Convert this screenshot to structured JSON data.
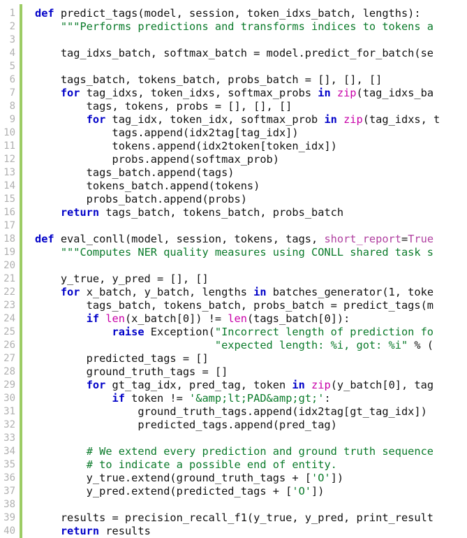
{
  "colors": {
    "keyword": "#0000c8",
    "string": "#0a7a2a",
    "comment": "#0a7a2a",
    "builtin": "#c800a8",
    "keyword_argument": "#b040a0",
    "line_number": "#b0b0b0",
    "change_bar": "#9ccc65",
    "text": "#111111"
  },
  "lines": [
    {
      "n": "1",
      "tokens": [
        {
          "t": "kw",
          "v": "def"
        },
        {
          "t": "p",
          "v": " predict_tags(model, session, token_idxs_batch, lengths):"
        }
      ]
    },
    {
      "n": "2",
      "tokens": [
        {
          "t": "p",
          "v": "    "
        },
        {
          "t": "str",
          "v": "\"\"\"Performs predictions and transforms indices to tokens a"
        }
      ]
    },
    {
      "n": "3",
      "tokens": []
    },
    {
      "n": "4",
      "tokens": [
        {
          "t": "p",
          "v": "    tag_idxs_batch, softmax_batch = model.predict_for_batch(se"
        }
      ]
    },
    {
      "n": "5",
      "tokens": []
    },
    {
      "n": "6",
      "tokens": [
        {
          "t": "p",
          "v": "    tags_batch, tokens_batch, probs_batch = [], [], []"
        }
      ]
    },
    {
      "n": "7",
      "tokens": [
        {
          "t": "p",
          "v": "    "
        },
        {
          "t": "kw",
          "v": "for"
        },
        {
          "t": "p",
          "v": " tag_idxs, token_idxs, softmax_probs "
        },
        {
          "t": "kw",
          "v": "in"
        },
        {
          "t": "p",
          "v": " "
        },
        {
          "t": "bi",
          "v": "zip"
        },
        {
          "t": "p",
          "v": "(tag_idxs_ba"
        }
      ]
    },
    {
      "n": "8",
      "tokens": [
        {
          "t": "p",
          "v": "        tags, tokens, probs = [], [], []"
        }
      ]
    },
    {
      "n": "9",
      "tokens": [
        {
          "t": "p",
          "v": "        "
        },
        {
          "t": "kw",
          "v": "for"
        },
        {
          "t": "p",
          "v": " tag_idx, token_idx, softmax_prob "
        },
        {
          "t": "kw",
          "v": "in"
        },
        {
          "t": "p",
          "v": " "
        },
        {
          "t": "bi",
          "v": "zip"
        },
        {
          "t": "p",
          "v": "(tag_idxs, t"
        }
      ]
    },
    {
      "n": "10",
      "tokens": [
        {
          "t": "p",
          "v": "            tags.append(idx2tag[tag_idx])"
        }
      ]
    },
    {
      "n": "11",
      "tokens": [
        {
          "t": "p",
          "v": "            tokens.append(idx2token[token_idx])"
        }
      ]
    },
    {
      "n": "12",
      "tokens": [
        {
          "t": "p",
          "v": "            probs.append(softmax_prob)"
        }
      ]
    },
    {
      "n": "13",
      "tokens": [
        {
          "t": "p",
          "v": "        tags_batch.append(tags)"
        }
      ]
    },
    {
      "n": "14",
      "tokens": [
        {
          "t": "p",
          "v": "        tokens_batch.append(tokens)"
        }
      ]
    },
    {
      "n": "15",
      "tokens": [
        {
          "t": "p",
          "v": "        probs_batch.append(probs)"
        }
      ]
    },
    {
      "n": "16",
      "tokens": [
        {
          "t": "p",
          "v": "    "
        },
        {
          "t": "kw",
          "v": "return"
        },
        {
          "t": "p",
          "v": " tags_batch, tokens_batch, probs_batch"
        }
      ]
    },
    {
      "n": "17",
      "tokens": []
    },
    {
      "n": "18",
      "tokens": [
        {
          "t": "kw",
          "v": "def"
        },
        {
          "t": "p",
          "v": " eval_conll(model, session, tokens, tags, "
        },
        {
          "t": "kwa",
          "v": "short_report"
        },
        {
          "t": "p",
          "v": "="
        },
        {
          "t": "kwa",
          "v": "True"
        }
      ]
    },
    {
      "n": "19",
      "tokens": [
        {
          "t": "p",
          "v": "    "
        },
        {
          "t": "str",
          "v": "\"\"\"Computes NER quality measures using CONLL shared task s"
        }
      ]
    },
    {
      "n": "20",
      "tokens": []
    },
    {
      "n": "21",
      "tokens": [
        {
          "t": "p",
          "v": "    y_true, y_pred = [], []"
        }
      ]
    },
    {
      "n": "22",
      "tokens": [
        {
          "t": "p",
          "v": "    "
        },
        {
          "t": "kw",
          "v": "for"
        },
        {
          "t": "p",
          "v": " x_batch, y_batch, lengths "
        },
        {
          "t": "kw",
          "v": "in"
        },
        {
          "t": "p",
          "v": " batches_generator(1, toke"
        }
      ]
    },
    {
      "n": "23",
      "tokens": [
        {
          "t": "p",
          "v": "        tags_batch, tokens_batch, probs_batch = predict_tags(m"
        }
      ]
    },
    {
      "n": "24",
      "tokens": [
        {
          "t": "p",
          "v": "        "
        },
        {
          "t": "kw",
          "v": "if"
        },
        {
          "t": "p",
          "v": " "
        },
        {
          "t": "bi",
          "v": "len"
        },
        {
          "t": "p",
          "v": "(x_batch[0]) != "
        },
        {
          "t": "bi",
          "v": "len"
        },
        {
          "t": "p",
          "v": "(tags_batch[0]):"
        }
      ]
    },
    {
      "n": "25",
      "tokens": [
        {
          "t": "p",
          "v": "            "
        },
        {
          "t": "kw",
          "v": "raise"
        },
        {
          "t": "p",
          "v": " Exception("
        },
        {
          "t": "str",
          "v": "\"Incorrect length of prediction fo"
        }
      ]
    },
    {
      "n": "26",
      "tokens": [
        {
          "t": "p",
          "v": "                            "
        },
        {
          "t": "str",
          "v": "\"expected length: %i, got: %i\""
        },
        {
          "t": "p",
          "v": " % ("
        }
      ]
    },
    {
      "n": "27",
      "tokens": [
        {
          "t": "p",
          "v": "        predicted_tags = []"
        }
      ]
    },
    {
      "n": "28",
      "tokens": [
        {
          "t": "p",
          "v": "        ground_truth_tags = []"
        }
      ]
    },
    {
      "n": "29",
      "tokens": [
        {
          "t": "p",
          "v": "        "
        },
        {
          "t": "kw",
          "v": "for"
        },
        {
          "t": "p",
          "v": " gt_tag_idx, pred_tag, token "
        },
        {
          "t": "kw",
          "v": "in"
        },
        {
          "t": "p",
          "v": " "
        },
        {
          "t": "bi",
          "v": "zip"
        },
        {
          "t": "p",
          "v": "(y_batch[0], tag"
        }
      ]
    },
    {
      "n": "30",
      "tokens": [
        {
          "t": "p",
          "v": "            "
        },
        {
          "t": "kw",
          "v": "if"
        },
        {
          "t": "p",
          "v": " token != "
        },
        {
          "t": "str",
          "v": "'&amp;lt;PAD&amp;gt;'"
        },
        {
          "t": "p",
          "v": ":"
        }
      ]
    },
    {
      "n": "31",
      "tokens": [
        {
          "t": "p",
          "v": "                ground_truth_tags.append(idx2tag[gt_tag_idx])"
        }
      ]
    },
    {
      "n": "32",
      "tokens": [
        {
          "t": "p",
          "v": "                predicted_tags.append(pred_tag)"
        }
      ]
    },
    {
      "n": "33",
      "tokens": []
    },
    {
      "n": "34",
      "tokens": [
        {
          "t": "p",
          "v": "        "
        },
        {
          "t": "cmt",
          "v": "# We extend every prediction and ground truth sequence"
        }
      ]
    },
    {
      "n": "35",
      "tokens": [
        {
          "t": "p",
          "v": "        "
        },
        {
          "t": "cmt",
          "v": "# to indicate a possible end of entity."
        }
      ]
    },
    {
      "n": "36",
      "tokens": [
        {
          "t": "p",
          "v": "        y_true.extend(ground_truth_tags + ["
        },
        {
          "t": "str",
          "v": "'O'"
        },
        {
          "t": "p",
          "v": "])"
        }
      ]
    },
    {
      "n": "37",
      "tokens": [
        {
          "t": "p",
          "v": "        y_pred.extend(predicted_tags + ["
        },
        {
          "t": "str",
          "v": "'O'"
        },
        {
          "t": "p",
          "v": "])"
        }
      ]
    },
    {
      "n": "38",
      "tokens": []
    },
    {
      "n": "39",
      "tokens": [
        {
          "t": "p",
          "v": "    results = precision_recall_f1(y_true, y_pred, print_result"
        }
      ]
    },
    {
      "n": "40",
      "tokens": [
        {
          "t": "p",
          "v": "    "
        },
        {
          "t": "kw",
          "v": "return"
        },
        {
          "t": "p",
          "v": " results"
        }
      ]
    }
  ]
}
